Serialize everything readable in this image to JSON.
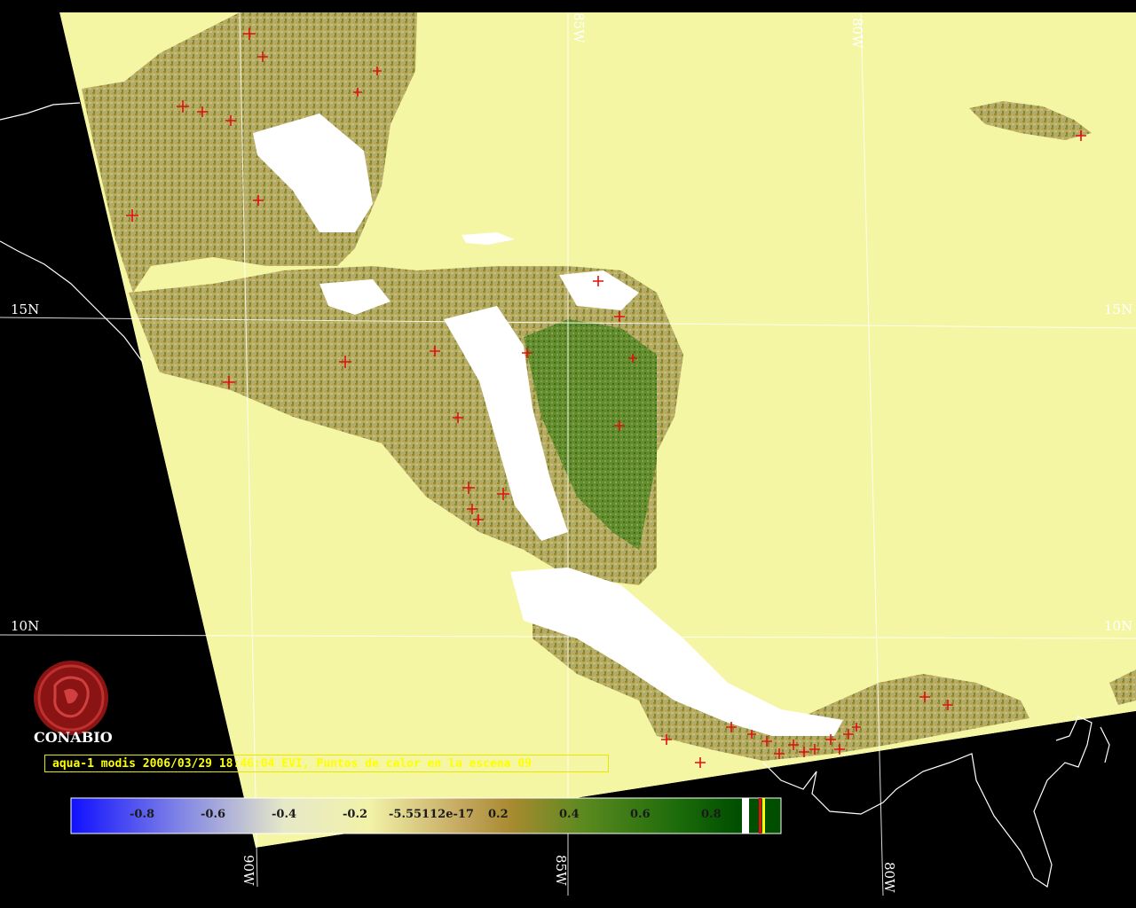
{
  "map": {
    "lat_labels_left": [
      "15N",
      "10N"
    ],
    "lat_labels_right": [
      "15N",
      "10N"
    ],
    "lon_labels_bottom": [
      "90W",
      "85W",
      "80W"
    ],
    "lon_labels_top": [
      "85W",
      "80W"
    ]
  },
  "organization": "CONABIO",
  "caption": "aqua-1 modis 2006/03/29 18:46:04 EVI, Puntos de calor en la escena 09",
  "legend": {
    "ticks": [
      "-0.8",
      "-0.6",
      "-0.4",
      "-0.2",
      "-5.55112e-17",
      "0.2",
      "0.4",
      "0.6",
      "0.8"
    ],
    "colors": {
      "low": "#1010ff",
      "mid": "#f2f2a8",
      "brown": "#a88a30",
      "high": "#004e00"
    }
  },
  "colors": {
    "ocean": "#f4f6a4",
    "background": "#000000",
    "cloud": "#ffffff",
    "hotspot": "#e01010"
  }
}
